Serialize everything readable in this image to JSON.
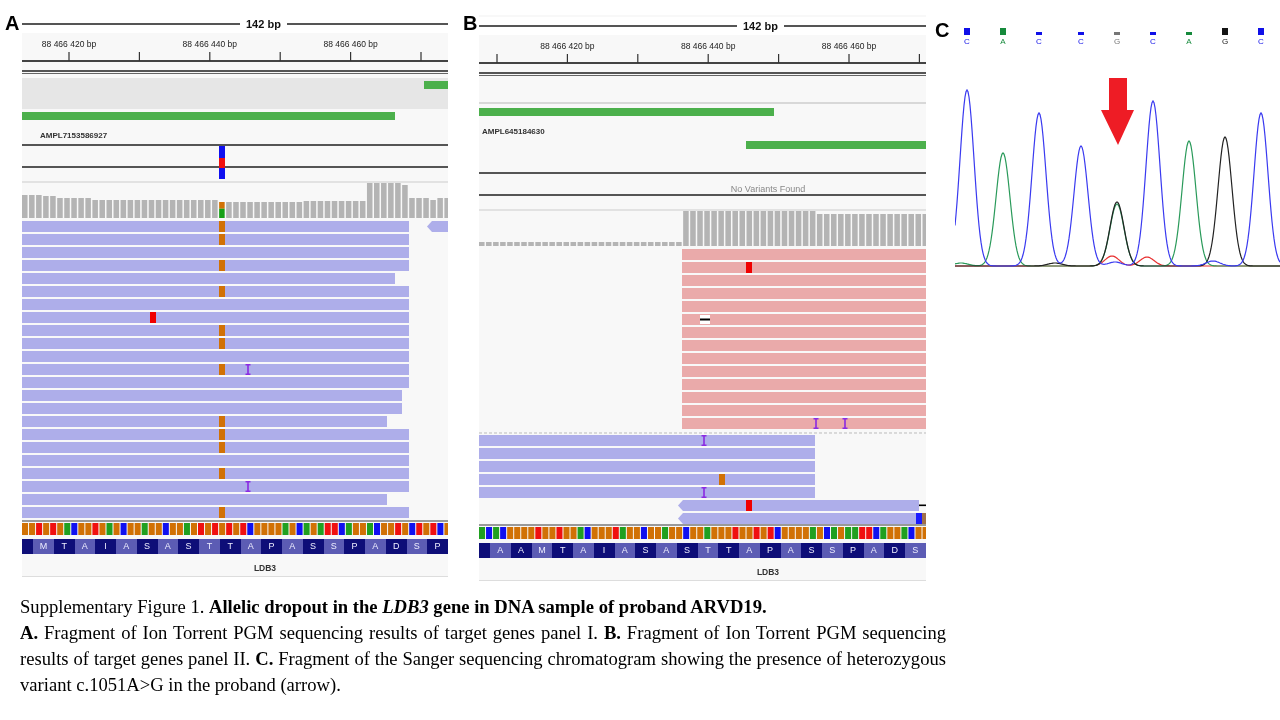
{
  "panels": [
    {
      "kind": "igv",
      "label": "A",
      "span": "142 bp",
      "ticks": [
        "88 466 420 bp",
        "88 466 440 bp",
        "88 466 460 bp"
      ],
      "amplicon": "AMPL7153586927",
      "variant_found": true,
      "gene": "LDB3",
      "amino_acids": [
        "M",
        "T",
        "A",
        "I",
        "A",
        "S",
        "A",
        "S",
        "T",
        "T",
        "A",
        "P",
        "A",
        "S",
        "S",
        "P",
        "A",
        "D",
        "S",
        "P"
      ]
    },
    {
      "kind": "igv",
      "label": "B",
      "span": "142 bp",
      "ticks": [
        "88 466 420 bp",
        "88 466 440 bp",
        "88 466 460 bp"
      ],
      "amplicon": "AMPL645184630",
      "variant_found": false,
      "variant_message": "No Variants Found",
      "gene": "LDB3",
      "amino_acids": [
        "A",
        "A",
        "M",
        "T",
        "A",
        "I",
        "A",
        "S",
        "A",
        "S",
        "T",
        "T",
        "A",
        "P",
        "A",
        "S",
        "S",
        "P",
        "A",
        "D",
        "S"
      ]
    },
    {
      "kind": "chromatogram",
      "label": "C",
      "bases": [
        {
          "base": "C",
          "color": "#1010e8",
          "low_quality": false
        },
        {
          "base": "A",
          "color": "#168a3c",
          "low_quality": false
        },
        {
          "base": "C",
          "color": "#1010e8",
          "low_quality": true
        },
        {
          "base": "C",
          "color": "#1010e8",
          "low_quality": true
        },
        {
          "base": "G",
          "color": "#767676",
          "low_quality": true
        },
        {
          "base": "C",
          "color": "#1010e8",
          "low_quality": true
        },
        {
          "base": "A",
          "color": "#168a3c",
          "low_quality": true
        },
        {
          "base": "G",
          "color": "#141414",
          "low_quality": false
        },
        {
          "base": "C",
          "color": "#1010e8",
          "low_quality": false
        }
      ]
    }
  ],
  "caption": {
    "label": "Supplementary Figure 1.",
    "title": "Allelic dropout in the *LDB3* gene in DNA sample of proband ARVD19.",
    "body": "**A.** Fragment of Ion Torrent PGM sequencing results of target genes panel I. **B.** Fragment of Ion Torrent PGM sequencing results of target genes panel II. **C.** Fragment of the Sanger sequencing chromatogram showing the presence of heterozygous variant c.1051A>G in the proband (arrow)."
  }
}
